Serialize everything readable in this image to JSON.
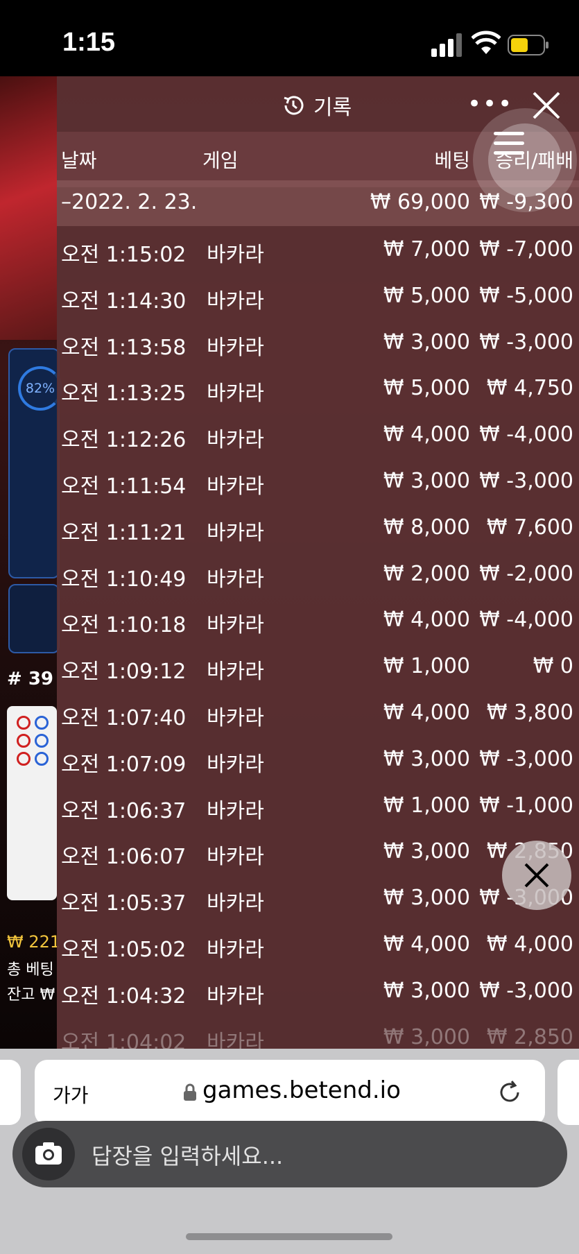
{
  "status_bar": {
    "time": "1:15"
  },
  "background_game": {
    "percent": "82%",
    "round": "# 39",
    "win_amount": "₩ 221",
    "bet_total": "총 베팅",
    "balance": "잔고 ₩"
  },
  "history": {
    "title": "기록",
    "columns": {
      "date": "날짜",
      "game": "게임",
      "bet": "베팅",
      "result": "승리/패배"
    },
    "date_group": {
      "date": "–2022. 2. 23.",
      "bet_total": "₩ 69,000",
      "result_total": "₩ -9,300"
    },
    "rows": [
      {
        "time": "오전 1:15:02",
        "game": "바카라",
        "bet": "₩ 7,000",
        "result": "₩ -7,000"
      },
      {
        "time": "오전 1:14:30",
        "game": "바카라",
        "bet": "₩ 5,000",
        "result": "₩ -5,000"
      },
      {
        "time": "오전 1:13:58",
        "game": "바카라",
        "bet": "₩ 3,000",
        "result": "₩ -3,000"
      },
      {
        "time": "오전 1:13:25",
        "game": "바카라",
        "bet": "₩ 5,000",
        "result": "₩ 4,750"
      },
      {
        "time": "오전 1:12:26",
        "game": "바카라",
        "bet": "₩ 4,000",
        "result": "₩ -4,000"
      },
      {
        "time": "오전 1:11:54",
        "game": "바카라",
        "bet": "₩ 3,000",
        "result": "₩ -3,000"
      },
      {
        "time": "오전 1:11:21",
        "game": "바카라",
        "bet": "₩ 8,000",
        "result": "₩ 7,600"
      },
      {
        "time": "오전 1:10:49",
        "game": "바카라",
        "bet": "₩ 2,000",
        "result": "₩ -2,000"
      },
      {
        "time": "오전 1:10:18",
        "game": "바카라",
        "bet": "₩ 4,000",
        "result": "₩ -4,000"
      },
      {
        "time": "오전 1:09:12",
        "game": "바카라",
        "bet": "₩ 1,000",
        "result": "₩ 0"
      },
      {
        "time": "오전 1:07:40",
        "game": "바카라",
        "bet": "₩ 4,000",
        "result": "₩ 3,800"
      },
      {
        "time": "오전 1:07:09",
        "game": "바카라",
        "bet": "₩ 3,000",
        "result": "₩ -3,000"
      },
      {
        "time": "오전 1:06:37",
        "game": "바카라",
        "bet": "₩ 1,000",
        "result": "₩ -1,000"
      },
      {
        "time": "오전 1:06:07",
        "game": "바카라",
        "bet": "₩ 3,000",
        "result": "₩ 2,850"
      },
      {
        "time": "오전 1:05:37",
        "game": "바카라",
        "bet": "₩ 3,000",
        "result": "₩ -3,000"
      },
      {
        "time": "오전 1:05:02",
        "game": "바카라",
        "bet": "₩ 4,000",
        "result": "₩ 4,000"
      },
      {
        "time": "오전 1:04:32",
        "game": "바카라",
        "bet": "₩ 3,000",
        "result": "₩ -3,000"
      },
      {
        "time": "오전 1:04:02",
        "game": "바카라",
        "bet": "₩ 3,000",
        "result": "₩ 2,850"
      }
    ]
  },
  "browser": {
    "text_size": "가가",
    "url": "games.betend.io",
    "reply_placeholder": "답장을 입력하세요..."
  }
}
